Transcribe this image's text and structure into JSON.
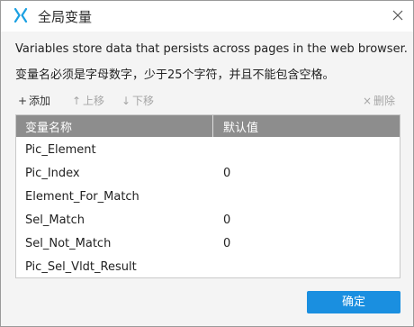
{
  "window": {
    "title": "全局变量",
    "logo_icon": "axure-x-logo-icon",
    "close_icon": "close-icon"
  },
  "description": {
    "line1": "Variables store data that persists across pages in the web browser.",
    "line2": "变量名必须是字母数字，少于25个字符，并且不能包含空格。"
  },
  "toolbar": {
    "add": {
      "glyph": "+",
      "label": "添加"
    },
    "move_up": {
      "glyph": "↑",
      "label": "上移"
    },
    "move_down": {
      "glyph": "↓",
      "label": "下移"
    },
    "delete": {
      "glyph": "×",
      "label": "删除"
    }
  },
  "table": {
    "columns": [
      "变量名称",
      "默认值"
    ],
    "rows": [
      {
        "name": "Pic_Element",
        "default": ""
      },
      {
        "name": "Pic_Index",
        "default": "0"
      },
      {
        "name": "Element_For_Match",
        "default": ""
      },
      {
        "name": "Sel_Match",
        "default": "0"
      },
      {
        "name": "Sel_Not_Match",
        "default": "0"
      },
      {
        "name": "Pic_Sel_Vldt_Result",
        "default": ""
      }
    ]
  },
  "footer": {
    "ok_label": "确定"
  },
  "colors": {
    "accent": "#1a8fe0",
    "header_bg": "#8d8d8d",
    "disabled_text": "#a6a6a6",
    "logo": "#1ba0e2"
  }
}
